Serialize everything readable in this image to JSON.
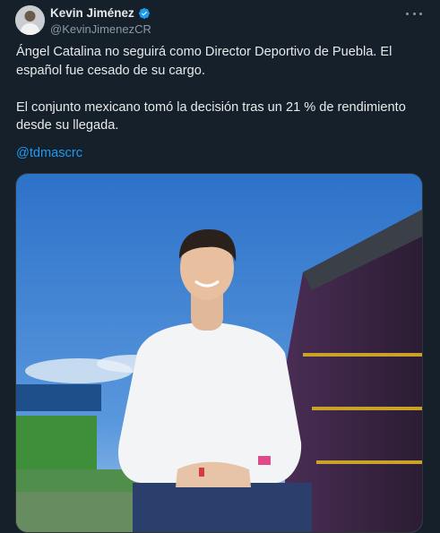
{
  "tweet": {
    "author_name": "Kevin Jiménez",
    "author_handle": "@KevinJimenezCR",
    "verified": true,
    "avatar_icon": "avatar-photo",
    "more_icon": "more-dots-icon",
    "text": "Ángel Catalina no seguirá como Director Deportivo de Puebla. El español fue cesado de su cargo.\n\nEl conjunto mexicano tomó la decisión tras un 21 % de rendimiento desde su llegada.",
    "mention": "@tdmascrc"
  },
  "colors": {
    "background": "#15202b",
    "text": "#e7e9ea",
    "secondary": "#8b98a5",
    "link": "#1d9bf0",
    "verified": "#1d9bf0"
  }
}
